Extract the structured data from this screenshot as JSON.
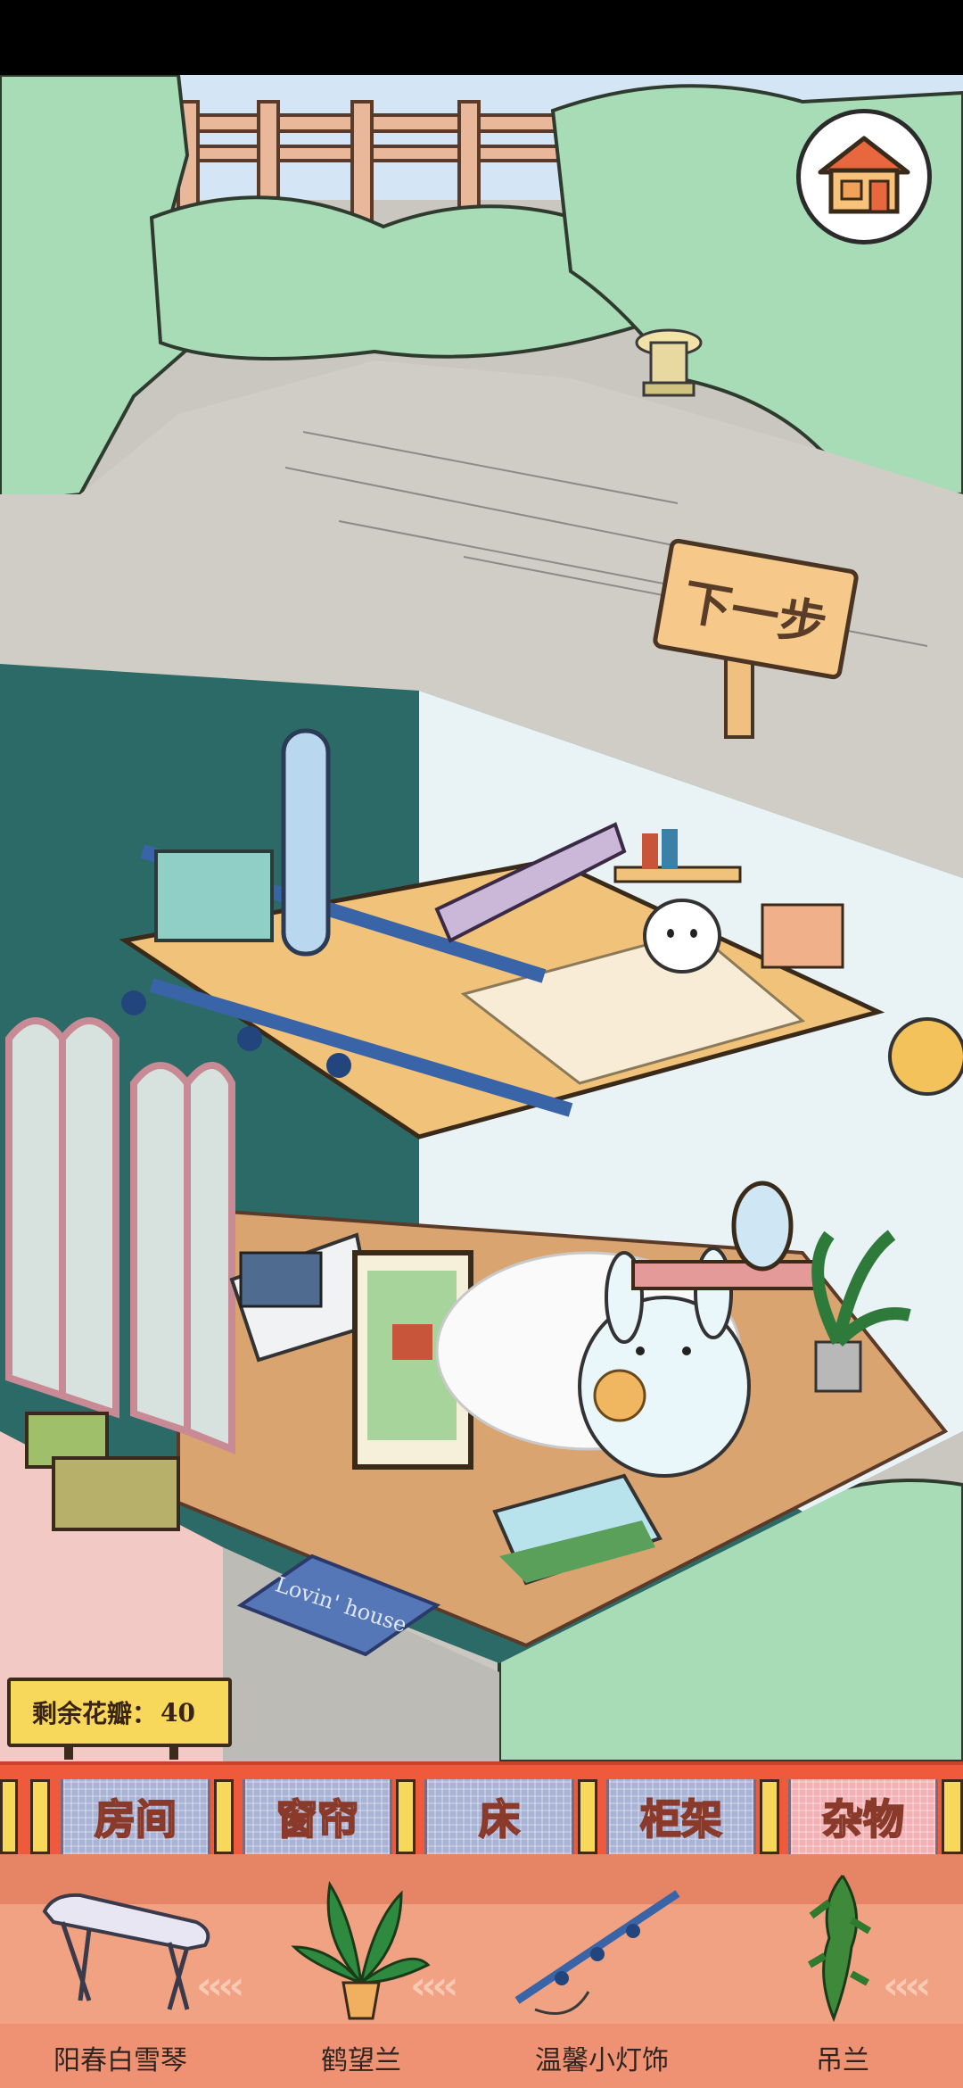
{
  "sign": {
    "next_label": "下一步"
  },
  "status": {
    "petals_label": "剩余花瓣：",
    "petals_value": "40"
  },
  "scene": {
    "doormat_text": "Lovin' house"
  },
  "tabs": [
    {
      "label": "房间",
      "active": false
    },
    {
      "label": "窗帘",
      "active": false
    },
    {
      "label": "床",
      "active": false
    },
    {
      "label": "柜架",
      "active": false
    },
    {
      "label": "杂物",
      "active": true
    }
  ],
  "items": [
    {
      "name": "阳春白雪琴",
      "icon": "guqin-icon"
    },
    {
      "name": "鹤望兰",
      "icon": "potted-plant-icon"
    },
    {
      "name": "温馨小灯饰",
      "icon": "track-light-icon"
    },
    {
      "name": "吊兰",
      "icon": "hanging-plant-icon"
    }
  ],
  "colors": {
    "tab_bar": "#f05a3c",
    "tab": "#a9b3d6",
    "tab_active": "#f3b1b6",
    "sign": "#f6c98b",
    "petal_board": "#f7d85a"
  }
}
